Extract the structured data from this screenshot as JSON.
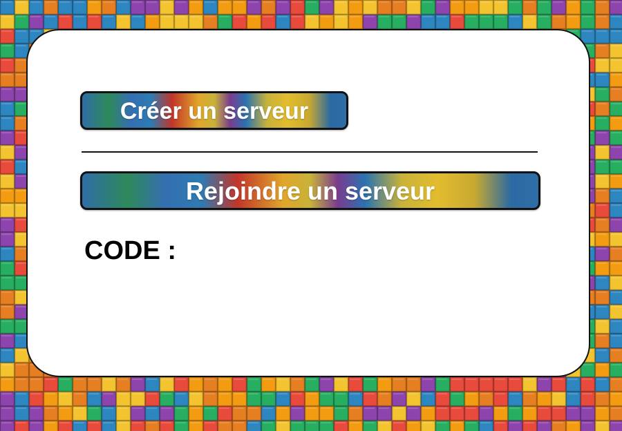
{
  "menu": {
    "create_server_label": "Créer un serveur",
    "join_server_label": "Rejoindre un serveur",
    "code_label": "CODE :",
    "code_value": ""
  },
  "background": {
    "pattern": "tetris-block-grid",
    "tile_colors": [
      "#e84a3c",
      "#f39c12",
      "#f4c430",
      "#27ae60",
      "#2e86c1",
      "#8e44ad",
      "#e67e22"
    ]
  }
}
